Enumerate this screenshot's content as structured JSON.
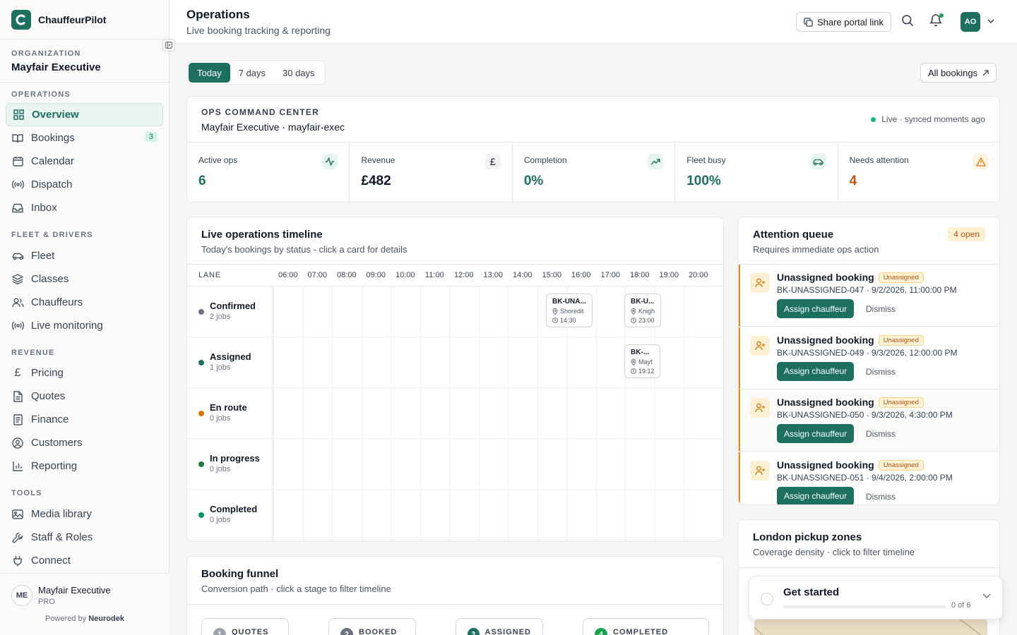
{
  "app": {
    "name": "ChauffeurPilot"
  },
  "organization": {
    "label": "ORGANIZATION",
    "name": "Mayfair Executive"
  },
  "sidebar": {
    "sections": [
      {
        "label": "OPERATIONS",
        "items": [
          {
            "label": "Overview",
            "icon": "grid-icon",
            "active": true
          },
          {
            "label": "Bookings",
            "icon": "book-icon",
            "badge": "3"
          },
          {
            "label": "Calendar",
            "icon": "calendar-icon"
          },
          {
            "label": "Dispatch",
            "icon": "radio-icon"
          },
          {
            "label": "Inbox",
            "icon": "inbox-icon"
          }
        ]
      },
      {
        "label": "FLEET & DRIVERS",
        "items": [
          {
            "label": "Fleet",
            "icon": "car-icon"
          },
          {
            "label": "Classes",
            "icon": "layers-icon"
          },
          {
            "label": "Chauffeurs",
            "icon": "users-icon"
          },
          {
            "label": "Live monitoring",
            "icon": "radio-icon"
          }
        ]
      },
      {
        "label": "REVENUE",
        "items": [
          {
            "label": "Pricing",
            "icon": "pound-icon"
          },
          {
            "label": "Quotes",
            "icon": "file-icon"
          },
          {
            "label": "Finance",
            "icon": "receipt-icon"
          },
          {
            "label": "Customers",
            "icon": "user-circle-icon"
          },
          {
            "label": "Reporting",
            "icon": "bar-chart-icon"
          }
        ]
      },
      {
        "label": "TOOLS",
        "items": [
          {
            "label": "Media library",
            "icon": "image-icon"
          },
          {
            "label": "Staff & Roles",
            "icon": "wrench-icon"
          },
          {
            "label": "Connect",
            "icon": "plug-icon"
          }
        ]
      }
    ],
    "account": {
      "initials": "ME",
      "name": "Mayfair Executive",
      "plan": "PRO"
    },
    "powered_by": "Powered by",
    "powered_brand": "Neurodek"
  },
  "header": {
    "title": "Operations",
    "subtitle": "Live booking tracking & reporting",
    "share_label": "Share portal link",
    "user_initials": "AO"
  },
  "range_tabs": [
    "Today",
    "7 days",
    "30 days"
  ],
  "range_selected": "Today",
  "all_bookings_label": "All bookings",
  "command_center": {
    "eyebrow": "OPS COMMAND CENTER",
    "title": "Mayfair Executive · mayfair-exec",
    "status": "Live · synced moments ago",
    "kpis": [
      {
        "label": "Active ops",
        "value": "6",
        "icon": "activity-icon",
        "color": "#1d6f5f"
      },
      {
        "label": "Revenue",
        "value": "£482",
        "icon": "pound-icon",
        "color": "#111827"
      },
      {
        "label": "Completion",
        "value": "0%",
        "icon": "trending-up-icon",
        "color": "#1d6f5f"
      },
      {
        "label": "Fleet busy",
        "value": "100%",
        "icon": "car-icon",
        "color": "#1d6f5f"
      },
      {
        "label": "Needs attention",
        "value": "4",
        "icon": "alert-triangle-icon",
        "color": "#c2560c"
      }
    ]
  },
  "timeline": {
    "title": "Live operations timeline",
    "subtitle": "Today's bookings by status - click a card for details",
    "lane_header": "LANE",
    "hours": [
      "06:00",
      "07:00",
      "08:00",
      "09:00",
      "10:00",
      "11:00",
      "12:00",
      "13:00",
      "14:00",
      "15:00",
      "16:00",
      "17:00",
      "18:00",
      "19:00",
      "20:00"
    ],
    "lanes": [
      {
        "name": "Confirmed",
        "count": "2 jobs",
        "color": "#6b7280"
      },
      {
        "name": "Assigned",
        "count": "1 jobs",
        "color": "#1d6f5f"
      },
      {
        "name": "En route",
        "count": "0 jobs",
        "color": "#d97706"
      },
      {
        "name": "In progress",
        "count": "0 jobs",
        "color": "#15803d"
      },
      {
        "name": "Completed",
        "count": "0 jobs",
        "color": "#059669"
      }
    ],
    "jobs": [
      {
        "lane": 0,
        "id": "BK-UNA...",
        "place": "Shoredit",
        "time": "14:30"
      },
      {
        "lane": 0,
        "id": "BK-U...",
        "place": "Knigh",
        "time": "23:00"
      },
      {
        "lane": 1,
        "id": "BK-...",
        "place": "Mayf",
        "time": "19:12"
      }
    ]
  },
  "attention": {
    "title": "Attention queue",
    "subtitle": "Requires immediate ops action",
    "open_label": "4 open",
    "items": [
      {
        "title": "Unassigned booking",
        "pill": "Unassigned",
        "meta": "BK-UNASSIGNED-047 · 9/2/2026, 11:00:00 PM"
      },
      {
        "title": "Unassigned booking",
        "pill": "Unassigned",
        "meta": "BK-UNASSIGNED-049 · 9/3/2026, 12:00:00 PM"
      },
      {
        "title": "Unassigned booking",
        "pill": "Unassigned",
        "meta": "BK-UNASSIGNED-050 · 9/3/2026, 4:30:00 PM"
      },
      {
        "title": "Unassigned booking",
        "pill": "Unassigned",
        "meta": "BK-UNASSIGNED-051 · 9/4/2026, 2:00:00 PM"
      }
    ],
    "assign_label": "Assign chauffeur",
    "dismiss_label": "Dismiss"
  },
  "funnel": {
    "title": "Booking funnel",
    "subtitle": "Conversion path · click a stage to filter timeline",
    "stages": [
      {
        "num": "1",
        "label": "QUOTES",
        "color": "#9ca3af"
      },
      {
        "num": "2",
        "label": "BOOKED",
        "color": "#6b7280"
      },
      {
        "num": "3",
        "label": "ASSIGNED",
        "color": "#1d6f5f"
      },
      {
        "num": "4",
        "label": "COMPLETED",
        "color": "#16a34a"
      }
    ]
  },
  "zones": {
    "title": "London pickup zones",
    "subtitle": "Coverage density · click to filter timeline"
  },
  "get_started": {
    "title": "Get started",
    "progress_text": "0 of 6",
    "progress_fraction": 0
  }
}
